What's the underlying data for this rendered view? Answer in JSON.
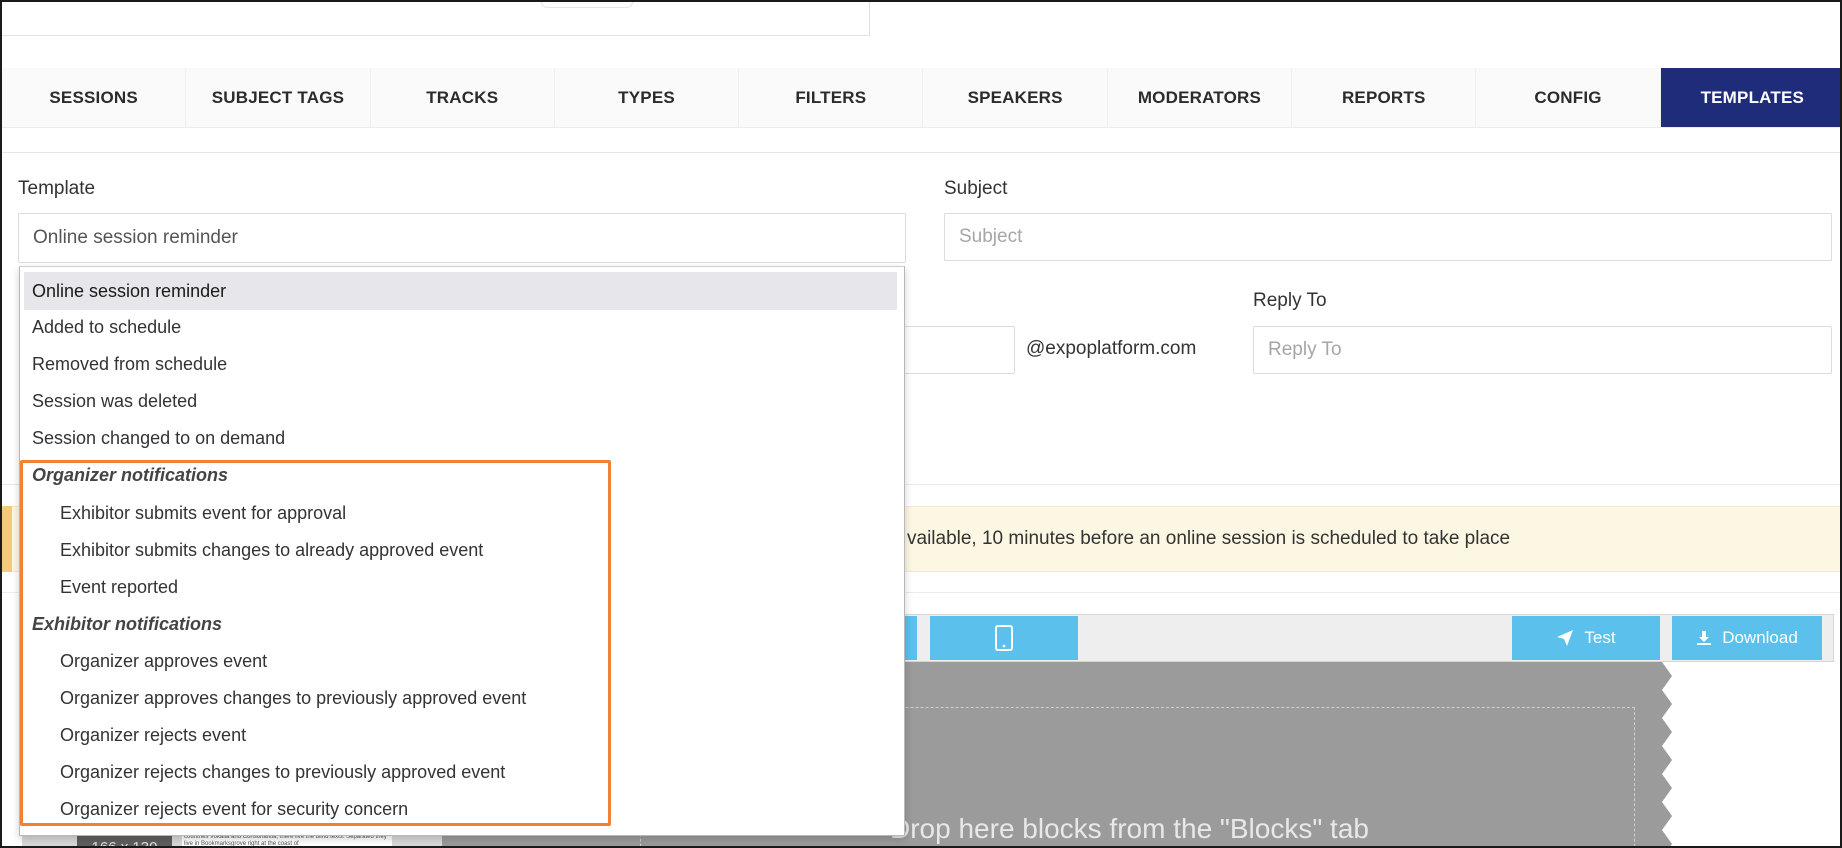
{
  "tabs": [
    {
      "label": "SESSIONS",
      "active": false
    },
    {
      "label": "SUBJECT TAGS",
      "active": false
    },
    {
      "label": "TRACKS",
      "active": false
    },
    {
      "label": "TYPES",
      "active": false
    },
    {
      "label": "FILTERS",
      "active": false
    },
    {
      "label": "SPEAKERS",
      "active": false
    },
    {
      "label": "MODERATORS",
      "active": false
    },
    {
      "label": "REPORTS",
      "active": false
    },
    {
      "label": "CONFIG",
      "active": false
    },
    {
      "label": "TEMPLATES",
      "active": true
    }
  ],
  "form": {
    "template_label": "Template",
    "template_value": "Online session reminder",
    "subject_label": "Subject",
    "subject_placeholder": "Subject",
    "reply_to_label": "Reply To",
    "reply_to_placeholder": "Reply To",
    "from_domain": "@expoplatform.com"
  },
  "banner": {
    "text": "vailable, 10 minutes before an online session is scheduled to take place"
  },
  "editor": {
    "test_label": "Test",
    "download_label": "Download",
    "drop_hint": "Drop here blocks from the \"Blocks\" tab",
    "thumb_size": "166 x 130",
    "thumb_snippet": "countries Vokalia and Consonantia, there live the blind texts. Separated they live in Bookmarksgrove right at the coast of"
  },
  "dropdown": {
    "options": [
      "Online session reminder",
      "Added to schedule",
      "Removed from schedule",
      "Session was deleted",
      "Session changed to on demand"
    ],
    "groups": [
      {
        "label": "Organizer notifications",
        "items": [
          "Exhibitor submits event for approval",
          "Exhibitor submits changes to already approved event",
          "Event reported"
        ]
      },
      {
        "label": "Exhibitor notifications",
        "items": [
          "Organizer approves event",
          "Organizer approves changes to previously approved event",
          "Organizer rejects event",
          "Organizer rejects changes to previously approved event",
          "Organizer rejects event for security concern"
        ]
      }
    ]
  },
  "colors": {
    "active_tab": "#1e2c7a",
    "toolbar_button": "#5bc0eb",
    "highlight_box": "#f08135",
    "banner_bg": "#fcf7e3"
  }
}
